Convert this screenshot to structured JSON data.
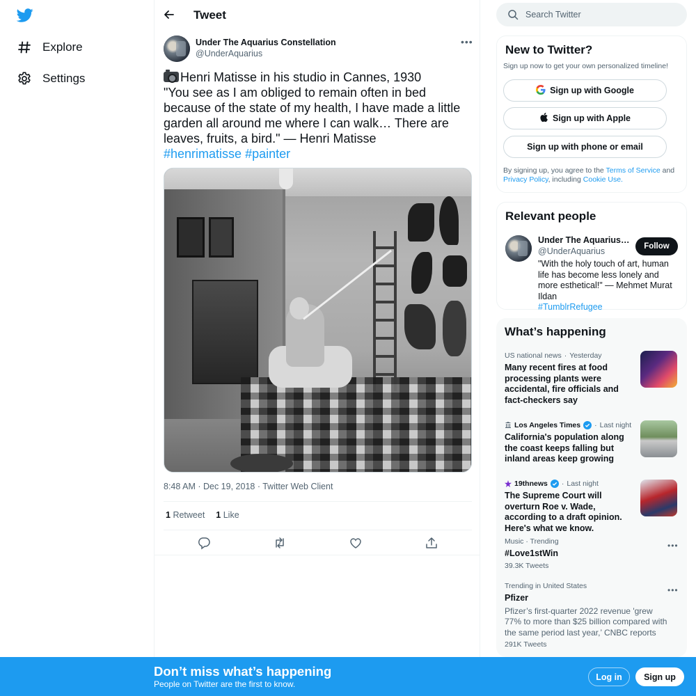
{
  "colors": {
    "brand": "#1d9bf0",
    "text": "#0f1419",
    "muted": "#536471"
  },
  "nav": {
    "explore": "Explore",
    "settings": "Settings"
  },
  "header": {
    "title": "Tweet"
  },
  "tweet": {
    "author_name": "Under The Aquarius Constellation",
    "author_handle": "@UnderAquarius",
    "lines": [
      "Henri Matisse in his studio in Cannes, 1930",
      "\"You see as I am obliged to remain often in bed",
      "because of the state of my health, I have made a little",
      "garden all around me where I can walk… There are",
      "leaves, fruits, a bird.\" — Henri Matisse"
    ],
    "hashtags": [
      "#henrimatisse",
      "#painter"
    ],
    "time": "8:48 AM",
    "date": "Dec 19, 2018",
    "client": "Twitter Web Client",
    "retweet_count": "1",
    "retweet_label": "Retweet",
    "like_count": "1",
    "like_label": "Like"
  },
  "search": {
    "placeholder": "Search Twitter"
  },
  "signup_card": {
    "title": "New to Twitter?",
    "subtitle": "Sign up now to get your own personalized timeline!",
    "google": "Sign up with Google",
    "apple": "Sign up with Apple",
    "phone": "Sign up with phone or email",
    "terms_prefix": "By signing up, you agree to the ",
    "terms_link": "Terms of Service",
    "terms_and": " and",
    "privacy_link": "Privacy Policy",
    "terms_mid": ", including ",
    "cookie_link": "Cookie Use."
  },
  "relevant": {
    "title": "Relevant people",
    "name": "Under The Aquarius Constellation",
    "handle": "@UnderAquarius",
    "follow": "Follow",
    "bio": "\"With the holy touch of art, human life has become less lonely and more esthetical!\" — Mehmet Murat Ildan",
    "bio_tag": "#TumblrRefugee"
  },
  "happening": {
    "title": "What’s happening",
    "items": [
      {
        "category": "US national news",
        "time": "Yesterday",
        "headline": "Many recent fires at food processing plants were accidental, fire officials and fact-checkers say"
      },
      {
        "source": "Los Angeles Times",
        "time": "Last night",
        "headline": "California's population along the coast keeps falling but inland areas keep growing"
      },
      {
        "source": "19thnews",
        "time": "Last night",
        "headline": "The Supreme Court will overturn Roe v. Wade, according to a draft opinion. Here's what we know."
      },
      {
        "category": "Music · Trending",
        "title": "#Love1stWin",
        "count": "39.3K Tweets"
      },
      {
        "category": "Trending in United States",
        "title": "Pfizer",
        "desc": "Pfizer’s first-quarter 2022 revenue 'grew 77% to more than $25 billion compared with the same period last year,’ CNBC reports",
        "count": "291K Tweets"
      }
    ]
  },
  "bottom_bar": {
    "title": "Don’t miss what’s happening",
    "subtitle": "People on Twitter are the first to know.",
    "login": "Log in",
    "signup": "Sign up"
  }
}
